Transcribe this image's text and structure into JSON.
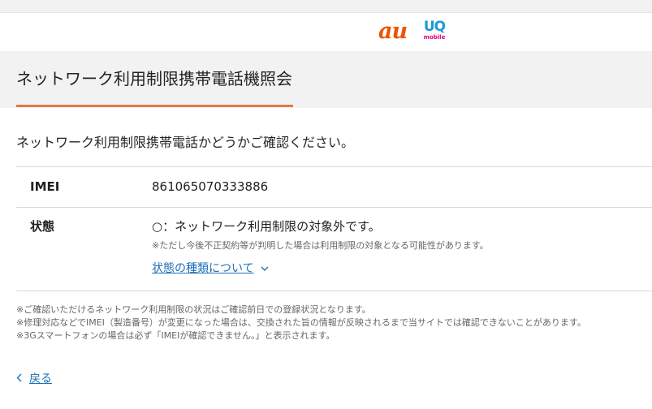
{
  "brand": {
    "au_logo": "au",
    "uq_logo_main": "UQ",
    "uq_logo_sub": "mobile",
    "colors": {
      "au": "#eb5505",
      "uq_blue": "#1a9ad6",
      "uq_pink": "#e4007f",
      "accent_underline": "#e07b45",
      "link": "#1d6fb8"
    }
  },
  "page": {
    "title": "ネットワーク利用制限携帯電話機照会",
    "intro": "ネットワーク利用制限携帯電話かどうかご確認ください。"
  },
  "result": {
    "imei_label": "IMEI",
    "imei_value": "861065070333886",
    "status_label": "状態",
    "status_value": "○：ネットワーク利用制限の対象外です。",
    "status_note": "※ただし今後不正契約等が判明した場合は利用制限の対象となる可能性があります。",
    "status_link": "状態の種類について",
    "status_link_icon": "chevron-down-icon"
  },
  "notes": [
    "※ご確認いただけるネットワーク利用制限の状況はご確認前日での登録状況となります。",
    "※修理対応などでIMEI（製造番号）が変更になった場合は、交換された旨の情報が反映されるまで当サイトでは確認できないことがあります。",
    "※3Gスマートフォンの場合は必ず「IMEIが確認できません。」と表示されます。"
  ],
  "back": {
    "label": "戻る",
    "icon": "chevron-left-icon"
  }
}
